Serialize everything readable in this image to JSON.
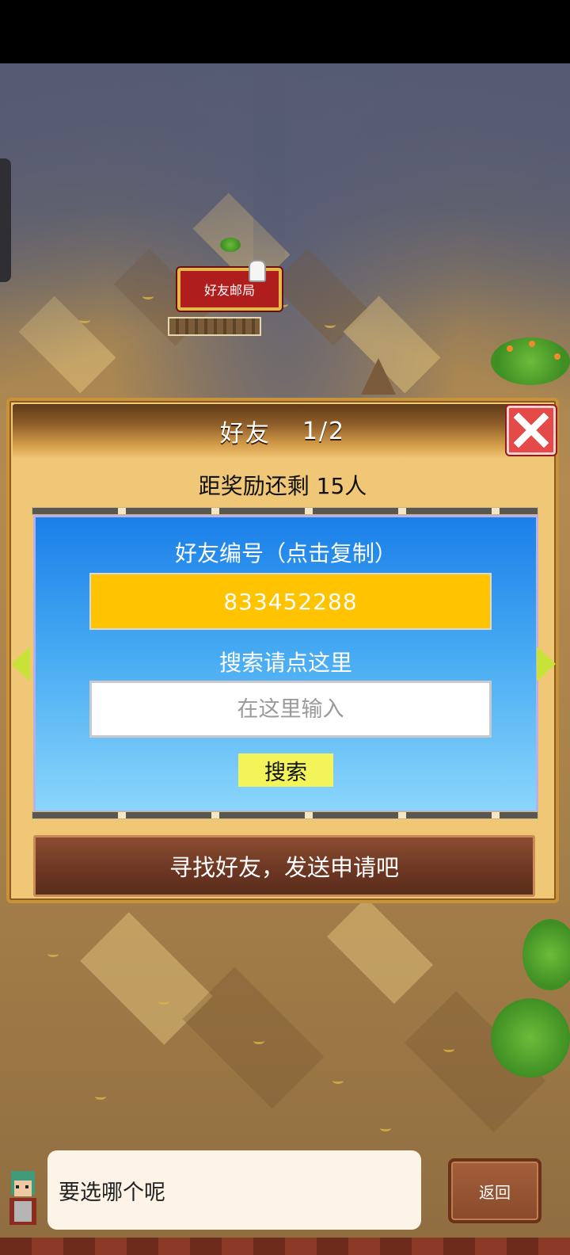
{
  "map": {
    "mailbox_sign": "好友邮局"
  },
  "dialog": {
    "title": "好友",
    "page": "1/2",
    "reward_text": "距奖励还剩 15人",
    "friend_id_title": "好友编号（点击复制）",
    "friend_id": "833452288",
    "search_hint": "搜索请点这里",
    "search_placeholder": "在这里输入",
    "search_button": "搜索",
    "find_friends_button": "寻找好友，发送申请吧"
  },
  "bottom": {
    "speech": "要选哪个呢",
    "back_button": "返回"
  },
  "colors": {
    "dialog_bg": "#efc777",
    "id_box": "#ffc300",
    "search_button": "#f2f45a",
    "close_button": "#e44a48"
  },
  "icons": {
    "close": "close-icon",
    "prev": "left-arrow-icon",
    "next": "right-arrow-icon"
  }
}
